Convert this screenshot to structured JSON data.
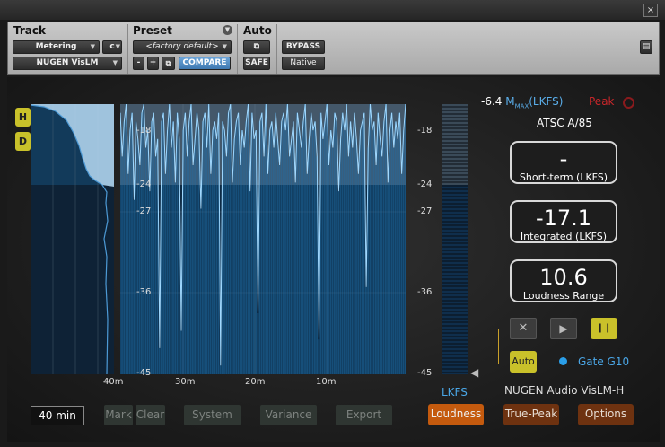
{
  "window": {
    "close_label": "×"
  },
  "header": {
    "track": {
      "title": "Track",
      "insert": "Metering",
      "channel": "c",
      "plugin": "NUGEN VisLM"
    },
    "preset": {
      "title": "Preset",
      "name": "<factory default>",
      "minus": "-",
      "plus": "+",
      "compare": "COMPARE"
    },
    "auto": {
      "title": "Auto",
      "safe": "SAFE"
    },
    "bypass": "BYPASS",
    "native": "Native"
  },
  "sidebar": {
    "h_label": "H",
    "d_label": "D"
  },
  "timeline": {
    "labels": [
      "40m",
      "30m",
      "20m",
      "10m"
    ],
    "window_value": "40 min"
  },
  "scale": {
    "left_ticks": [
      "-18",
      "-24",
      "-27",
      "-36",
      "-45"
    ],
    "right_ticks": [
      "-18",
      "-24",
      "-27",
      "-36",
      "-45"
    ],
    "meter_label": "LKFS"
  },
  "chart_data": {
    "type": "line",
    "title": "",
    "ylabel": "LKFS",
    "ylim": [
      -45,
      -14
    ],
    "x_labels": [
      "40m",
      "30m",
      "20m",
      "10m"
    ],
    "series": [
      {
        "name": "",
        "values": [
          -15,
          -20,
          -16,
          -14,
          -22,
          -17,
          -15,
          -25,
          -16,
          -18,
          -21,
          -15,
          -14,
          -19,
          -17,
          -24,
          -16,
          -15,
          -20,
          -18,
          -42,
          -16,
          -15,
          -22,
          -17,
          -14,
          -19,
          -16,
          -23,
          -15,
          -18,
          -40,
          -17,
          -15,
          -20,
          -16,
          -14,
          -21,
          -18,
          -15,
          -17,
          -26,
          -16,
          -15,
          -19,
          -14,
          -22,
          -17,
          -16,
          -18,
          -15,
          -44,
          -16,
          -17,
          -20,
          -15,
          -14,
          -23,
          -18,
          -16,
          -15,
          -21,
          -17,
          -19,
          -16,
          -14,
          -24,
          -15,
          -18,
          -17,
          -38,
          -16,
          -15,
          -20,
          -14,
          -22,
          -17,
          -16,
          -19,
          -15,
          -18,
          -21,
          -16,
          -15,
          -17,
          -14,
          -20,
          -18,
          -16,
          -23,
          -15,
          -17,
          -19,
          -16,
          -14,
          -22,
          -18,
          -15,
          -17,
          -16,
          -20,
          -41,
          -15,
          -18,
          -16,
          -14,
          -21,
          -17,
          -19,
          -15,
          -16,
          -24,
          -18,
          -15,
          -17,
          -14,
          -20,
          -16,
          -19,
          -15,
          -18,
          -22,
          -17,
          -16,
          -15,
          -35,
          -19,
          -14,
          -17,
          -16,
          -21,
          -15,
          -18,
          -20,
          -16,
          -14,
          -23,
          -17,
          -15,
          -19,
          -16,
          -18,
          -15,
          -22,
          -17,
          -14
        ]
      }
    ]
  },
  "readouts": {
    "max_value": "-6.4",
    "max_label_m": "M",
    "max_label_sub": "MAX",
    "max_label_unit": "(LKFS)",
    "peak_label": "Peak",
    "standard": "ATSC A/85",
    "short_term": {
      "value": "-",
      "label": "Short-term (LKFS)"
    },
    "integrated": {
      "value": "-17.1",
      "label": "Integrated (LKFS)"
    },
    "range": {
      "value": "10.6",
      "label": "Loudness Range"
    }
  },
  "transport": {
    "reset_icon": "✕",
    "play_icon": "▶",
    "pause_icon": "❙❙",
    "auto": "Auto",
    "gate": "Gate G10"
  },
  "brand": "NUGEN Audio VisLM-H",
  "bottom_buttons": {
    "mark": "Mark",
    "clear": "Clear",
    "system": "System",
    "variance": "Variance",
    "export": "Export"
  },
  "tabs": {
    "loudness": "Loudness",
    "true_peak": "True-Peak",
    "options": "Options"
  },
  "colors": {
    "accent_yellow": "#c9c12a",
    "accent_orange": "#c45a0e",
    "meter_blue": "#7fc8ff"
  }
}
